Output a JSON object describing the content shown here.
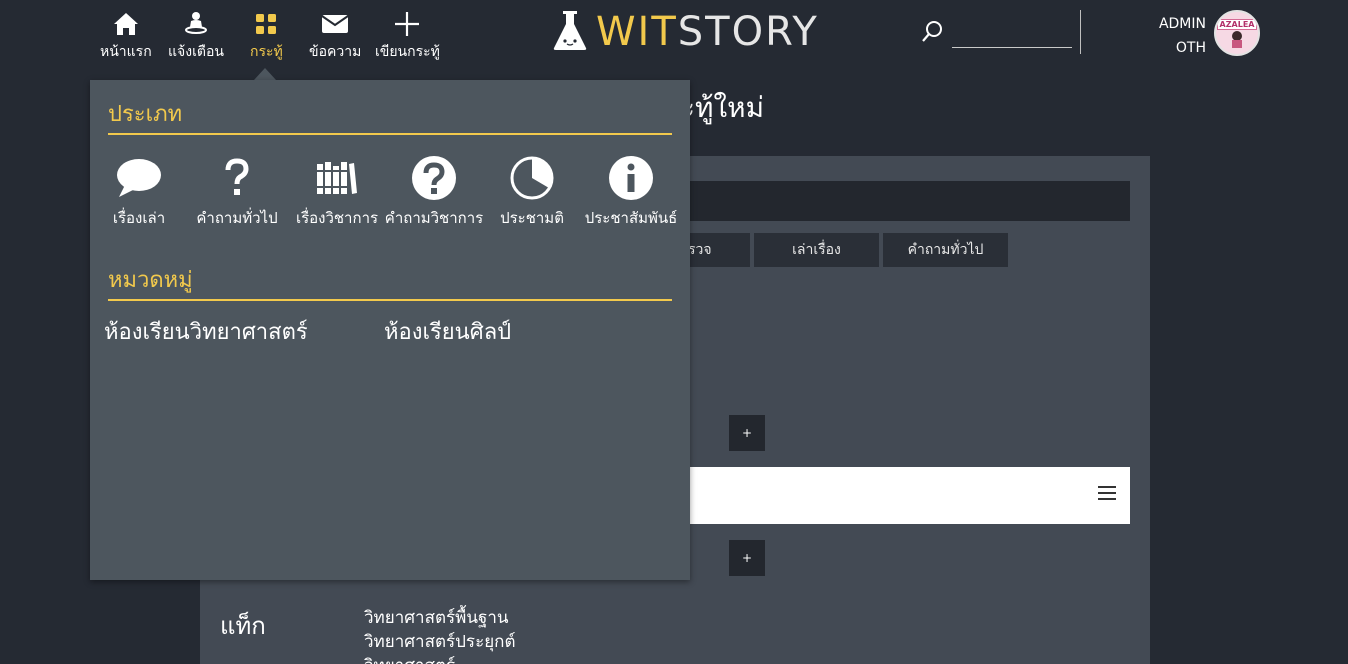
{
  "nav": {
    "items": [
      {
        "label": "หน้าแรก",
        "icon": "home-icon"
      },
      {
        "label": "แจ้งเตือน",
        "icon": "notification-icon"
      },
      {
        "label": "กระทู้",
        "icon": "grid-icon"
      },
      {
        "label": "ข้อความ",
        "icon": "mail-icon"
      },
      {
        "label": "เขียนกระทู้",
        "icon": "plus-icon"
      }
    ]
  },
  "logo": {
    "part1": "WIT",
    "part2": "STORY",
    "icon": "flask-icon"
  },
  "search": {
    "icon": "search-icon",
    "value": ""
  },
  "user": {
    "line1": "ADMIN",
    "line2": "OTH",
    "avatar_text": "AZALEA"
  },
  "page": {
    "title": "ะทู้ใหม่",
    "tabs": [
      {
        "label": "รวจ"
      },
      {
        "label": "เล่าเรื่อง"
      },
      {
        "label": "คำถามทั่วไป"
      }
    ],
    "plus_label": "+",
    "tags_label": "แท็ก",
    "tags": [
      "วิทยาศาสตร์พื้นฐาน",
      "วิทยาศาสตร์ประยุกต์",
      "วิทยาศาสตร์..."
    ]
  },
  "dropdown": {
    "types_title": "ประเภท",
    "types": [
      {
        "label": "เรื่องเล่า",
        "icon": "speech-bubble-icon"
      },
      {
        "label": "คำถามทั่วไป",
        "icon": "question-mark-icon"
      },
      {
        "label": "เรื่องวิชาการ",
        "icon": "books-icon"
      },
      {
        "label": "คำถามวิชาการ",
        "icon": "question-circle-icon"
      },
      {
        "label": "ประชามติ",
        "icon": "pie-chart-icon"
      },
      {
        "label": "ประชาสัมพันธ์",
        "icon": "info-icon"
      }
    ],
    "categories_title": "หมวดหมู่",
    "categories": [
      {
        "label": "ห้องเรียนวิทยาศาสตร์"
      },
      {
        "label": "ห้องเรียนศิลป์"
      }
    ]
  },
  "colors": {
    "accent": "#f2c94c",
    "background": "#252a33",
    "dropdown": "#4d565e",
    "panel": "#434a54"
  }
}
